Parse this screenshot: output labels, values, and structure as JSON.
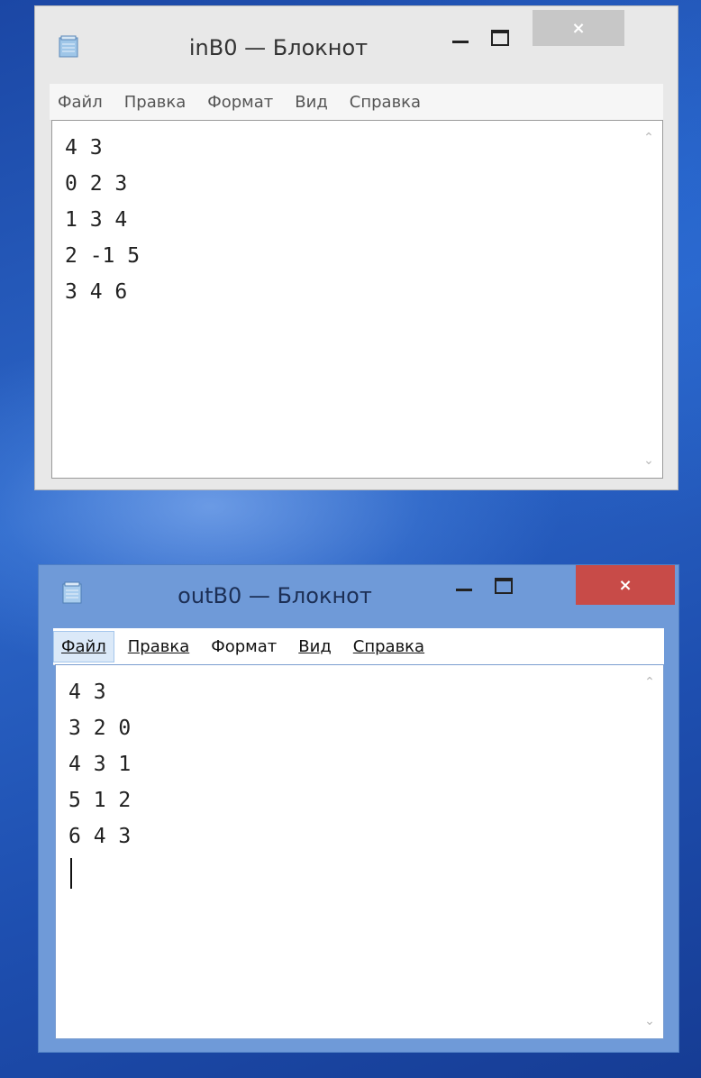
{
  "windows": [
    {
      "title": "inB0 — Блокнот",
      "menu": [
        "Файл",
        "Правка",
        "Формат",
        "Вид",
        "Справка"
      ],
      "lines": [
        "4 3",
        "0 2 3",
        "1 3 4",
        "2 -1 5",
        "3 4 6"
      ],
      "close_glyph": "×",
      "scroll_up_glyph": "⌃",
      "scroll_down_glyph": "⌄"
    },
    {
      "title": "outB0 — Блокнот",
      "menu": [
        "Файл",
        "Правка",
        "Формат",
        "Вид",
        "Справка"
      ],
      "lines": [
        "4 3",
        "3 2 0",
        "4 3 1",
        "5 1 2",
        "6 4 3"
      ],
      "close_glyph": "×",
      "scroll_up_glyph": "⌃",
      "scroll_down_glyph": "⌄",
      "active_menu": "Файл"
    }
  ],
  "colors": {
    "desktop": "#1f4aa8",
    "close_active": "#c84b48",
    "close_inactive": "#c7c7c7"
  },
  "icons": [
    "notepad-icon",
    "minimize-icon",
    "maximize-icon",
    "close-icon",
    "scroll-up-icon",
    "scroll-down-icon"
  ]
}
